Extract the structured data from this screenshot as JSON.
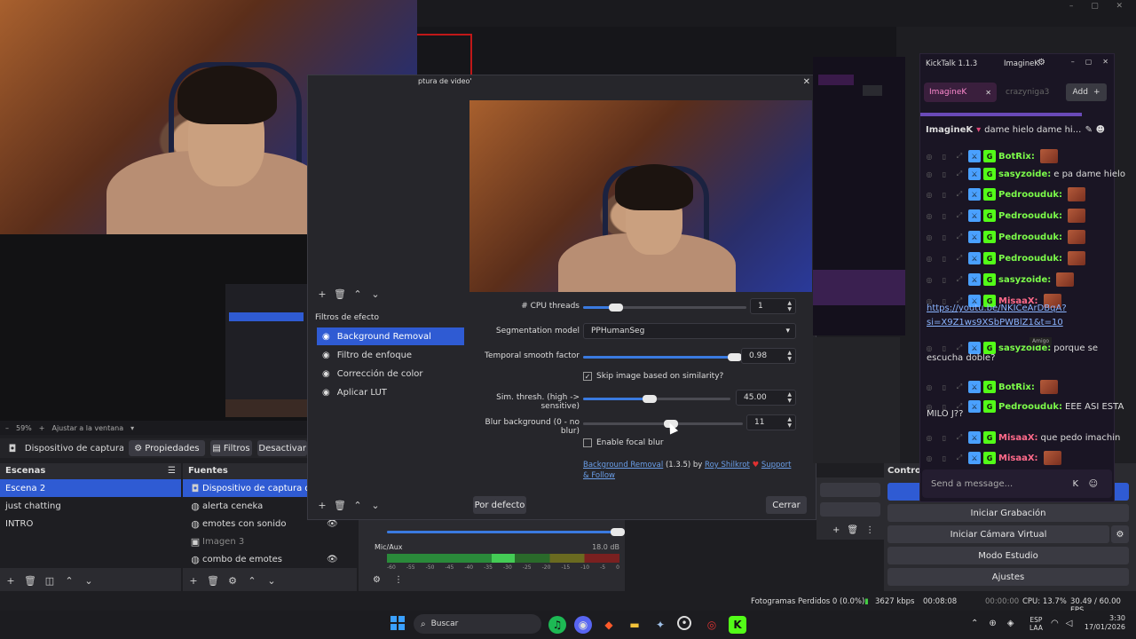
{
  "obs": {
    "zoom": "59%",
    "zoom_mode": "Ajustar a la ventana",
    "source_toolbar": {
      "source_name": "Dispositivo de captura de v",
      "properties": "Propiedades",
      "filters": "Filtros",
      "deactivate": "Desactivar"
    },
    "scenes": {
      "title": "Escenas",
      "items": [
        "Escena 2",
        "just chatting",
        "INTRO"
      ]
    },
    "sources": {
      "title": "Fuentes",
      "items": [
        "Dispositivo de captura de video",
        "alerta ceneka",
        "emotes con sonido",
        "Imagen 3",
        "combo de emotes"
      ]
    },
    "audio": {
      "mic_label": "Mic/Aux",
      "mic_db": "18.0 dB",
      "scale": [
        "-60",
        "-55",
        "-50",
        "-45",
        "-40",
        "-35",
        "-30",
        "-25",
        "-20",
        "-15",
        "-10",
        "-5",
        "0"
      ]
    },
    "controls": {
      "title": "Controles",
      "start_recording": "Iniciar Grabación",
      "start_virtual_cam": "Iniciar Cámara Virtual",
      "studio_mode": "Modo Estudio",
      "settings": "Ajustes"
    },
    "status": {
      "dropped": "Fotogramas Perdidos 0 (0.0%)",
      "bitrate": "3627 kbps",
      "stream_time": "00:08:08",
      "rec_time": "00:00:00",
      "cpu": "CPU: 13.7%",
      "fps": "30.49 / 60.00 FPS"
    }
  },
  "filters_dialog": {
    "title": "ptura de video'",
    "effect_filters_label": "Filtros de efecto",
    "filters": [
      {
        "name": "Background Removal",
        "selected": true
      },
      {
        "name": "Filtro de enfoque",
        "selected": false
      },
      {
        "name": "Corrección de color",
        "selected": false
      },
      {
        "name": "Aplicar LUT",
        "selected": false
      }
    ],
    "params": {
      "cpu_threads": {
        "label": "# CPU threads",
        "value": "1",
        "fraction": 0.2
      },
      "segmentation_model": {
        "label": "Segmentation model",
        "value": "PPHumanSeg"
      },
      "temporal_smooth": {
        "label": "Temporal smooth factor",
        "value": "0.98",
        "fraction": 0.98
      },
      "skip_image": {
        "label": "Skip image based on similarity?",
        "checked": true
      },
      "sim_thresh": {
        "label": "Sim. thresh. (high -> sensitive)",
        "value": "45.00",
        "fraction": 0.45
      },
      "blur_background": {
        "label": "Blur background (0 - no blur)",
        "value": "11",
        "fraction": 0.55
      },
      "focal_blur": {
        "label": "Enable focal blur",
        "checked": false
      }
    },
    "footer_link": "Background Removal",
    "footer_version": "(1.3.5) by",
    "footer_author": "Roy Shilkrot",
    "footer_support": "Support & Follow",
    "defaults_button": "Por defecto",
    "close_button": "Cerrar"
  },
  "kicktalk": {
    "app_title": "KickTalk 1.1.3",
    "user": "ImagineK",
    "tabs": [
      {
        "name": "ImagineK",
        "active": true
      },
      {
        "name": "crazyniga3",
        "active": false
      }
    ],
    "add_label": "Add",
    "header_user": "ImagineK",
    "header_msg": "dame hielo dame hi...",
    "messages": [
      {
        "user": "BotRix:",
        "text": "",
        "color": "#7cfc4a"
      },
      {
        "user": "sasyzoide:",
        "text": "e pa dame hielo",
        "color": "#7cfc4a"
      },
      {
        "user": "Pedroouduk:",
        "text": "",
        "color": "#7cfc4a"
      },
      {
        "user": "Pedroouduk:",
        "text": "",
        "color": "#7cfc4a"
      },
      {
        "user": "Pedroouduk:",
        "text": "",
        "color": "#7cfc4a"
      },
      {
        "user": "Pedroouduk:",
        "text": "",
        "color": "#7cfc4a"
      },
      {
        "user": "sasyzoide:",
        "text": "",
        "color": "#7cfc4a"
      },
      {
        "user": "MisaaX:",
        "text": "",
        "color": "#ff6a8a"
      },
      {
        "user": "sasyzoide:",
        "text": "porque se",
        "color": "#7cfc4a"
      },
      {
        "user": "BotRix:",
        "text": "",
        "color": "#7cfc4a"
      },
      {
        "user": "Pedroouduk:",
        "text": "EEE ASI ESTA",
        "color": "#7cfc4a"
      },
      {
        "user": "MisaaX:",
        "text": "que pedo imachin",
        "color": "#ff6a8a"
      },
      {
        "user": "MisaaX:",
        "text": "",
        "color": "#ff6a8a"
      }
    ],
    "link_line1": "https://youtu.be/NKICeArDBqA?",
    "link_line2": "si=X9Z1ws9XSbPWBlZ1&t=10",
    "continuation1": "escucha doble?",
    "continuation2": "MILO J??",
    "amigo_tag": "Amigo",
    "input_placeholder": "Send a message..."
  },
  "taskbar": {
    "search": "Buscar",
    "lang1": "ESP",
    "lang2": "LAA",
    "time": "3:30",
    "date": "17/01/2026"
  }
}
